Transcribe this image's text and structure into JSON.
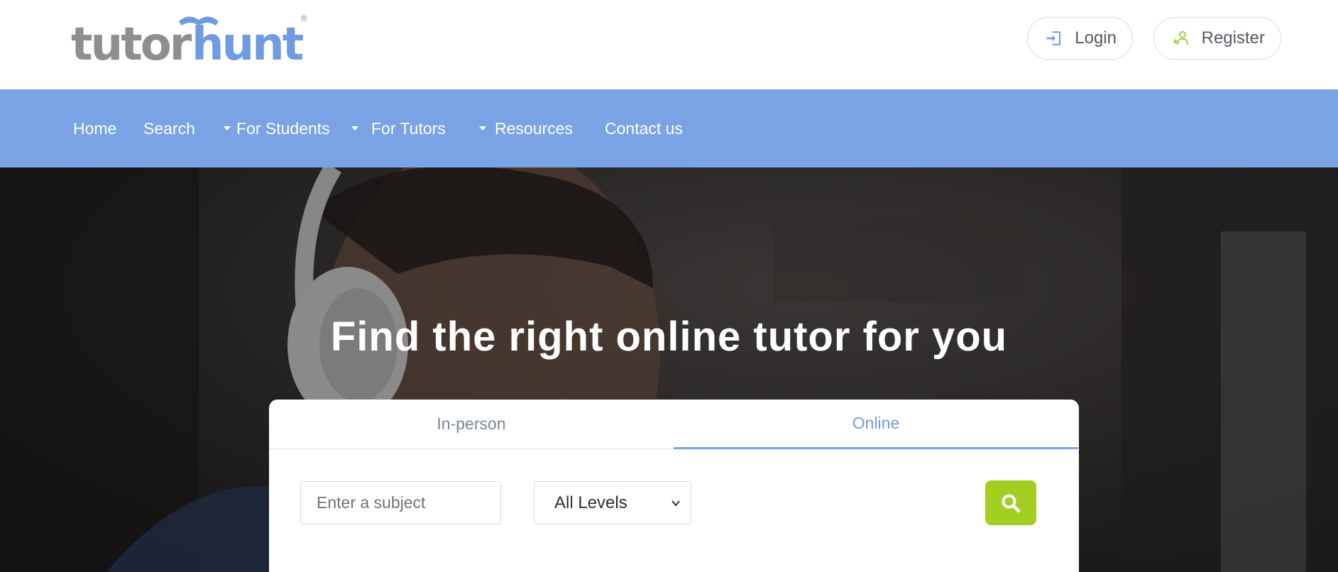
{
  "header": {
    "logo": {
      "part1": "tutor",
      "part2": "hunt",
      "mark": "®"
    },
    "login_label": "Login",
    "register_label": "Register",
    "icons": {
      "login": "login-icon",
      "register": "add-user-icon"
    },
    "colors": {
      "logo_grey": "#8e8e8e",
      "logo_blue": "#6f9be0",
      "register_icon": "#9bcb2f",
      "login_icon": "#6f9be0"
    }
  },
  "nav": {
    "background": "#7aa3e5",
    "items": [
      {
        "label": "Home",
        "dropdown": false
      },
      {
        "label": "Search",
        "dropdown": false
      },
      {
        "label": "For Students",
        "dropdown": true
      },
      {
        "label": "For Tutors",
        "dropdown": true
      },
      {
        "label": "Resources",
        "dropdown": true
      },
      {
        "label": "Contact us",
        "dropdown": false
      }
    ]
  },
  "hero": {
    "title": "Find the right online tutor for you"
  },
  "search": {
    "tabs": [
      {
        "label": "In-person",
        "active": false
      },
      {
        "label": "Online",
        "active": true
      }
    ],
    "subject_placeholder": "Enter a subject",
    "subject_value": "",
    "level_selected": "All Levels",
    "search_button_icon": "search-icon",
    "search_button_color": "#a3cf22"
  }
}
